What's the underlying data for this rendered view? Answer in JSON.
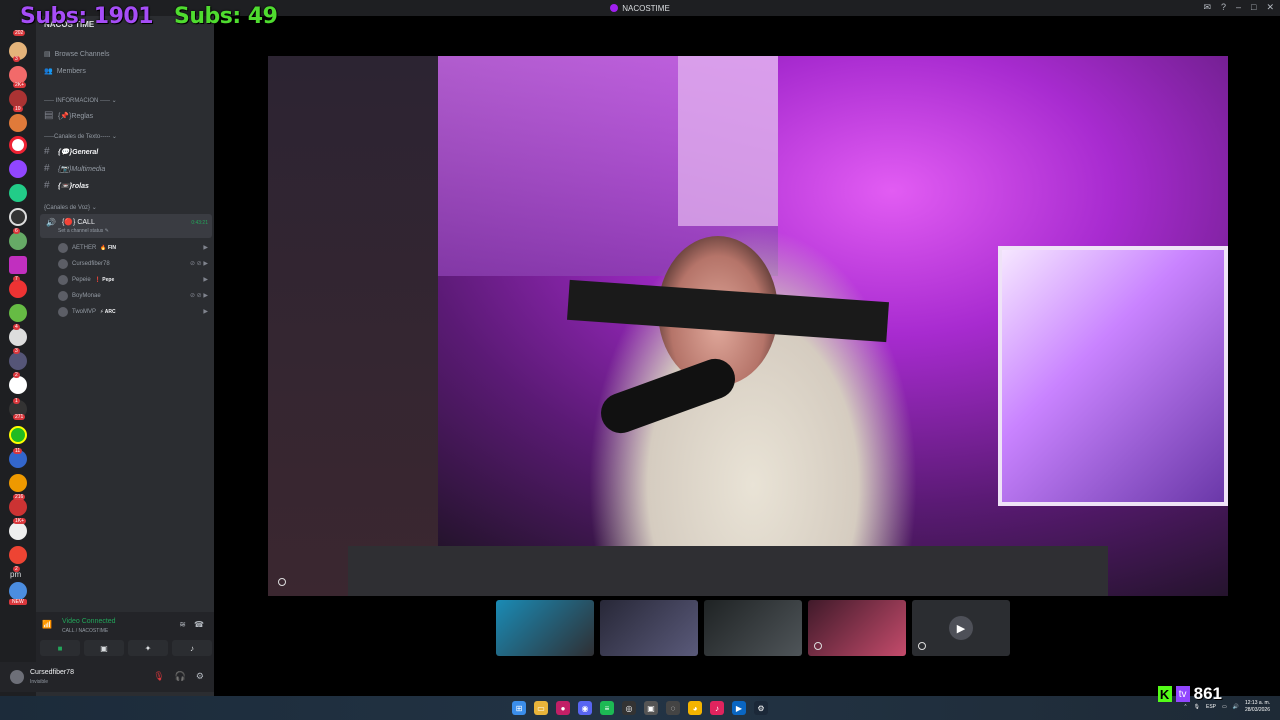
{
  "overlay": {
    "subs_left": "Subs: 1901",
    "subs_right": "Subs: 49",
    "viewer_count": "861",
    "kick_glyph": "K",
    "twitch_glyph": "tv"
  },
  "window": {
    "title": "NACOSTIME"
  },
  "sidebar": {
    "server_name": "NACOS TIME",
    "browse_channels": "Browse Channels",
    "members": "Members",
    "cat_info": "----- INFORMACION ----- ⌄",
    "reglas": "{📌}Reglas",
    "cat_text": "-----Canales de Texto----- ⌄",
    "text_channels": [
      "{💬}General",
      "{📷}Multimedia",
      "{📼}rolas"
    ],
    "cat_voice": "{Canales de Voz} ⌄",
    "call": {
      "name": "{🔴} CALL",
      "status": "Set a channel status ✎",
      "time": "0:43:21"
    },
    "voice_users": [
      {
        "name": "AETHER",
        "tag": "🔥 FIN"
      },
      {
        "name": "Cursedfiber78",
        "tag": ""
      },
      {
        "name": "Pepeie",
        "tag": "❗ Pepe"
      },
      {
        "name": "BoyMonae",
        "tag": ""
      },
      {
        "name": "TwoMVP",
        "tag": "⚡ ARC"
      }
    ]
  },
  "server_badges": [
    "202",
    "3",
    "2K+",
    "10",
    "6",
    "7",
    "4",
    "3",
    "2",
    "1",
    "271",
    "11",
    "216",
    "1K+",
    "2"
  ],
  "server_glyph": "pm",
  "new_tag": "NEW",
  "voice_panel": {
    "title": "Video Connected",
    "subtitle": "CALL / NACOSTIME"
  },
  "user_panel": {
    "name": "Cursedfiber78",
    "status": "Invisible"
  },
  "taskbar": {
    "lang": "ESP",
    "time": "12:13 a. m.",
    "date": "28/03/2026"
  },
  "colors": {
    "subs_left": "#a64df7",
    "subs_right": "#4fdc2f",
    "voice_green": "#23a55a",
    "accent": "#a020f0"
  }
}
